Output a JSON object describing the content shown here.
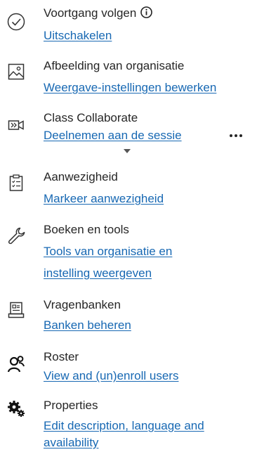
{
  "items": [
    {
      "title": "Voortgang volgen",
      "link": "Uitschakelen",
      "icon": "check-circle-icon"
    },
    {
      "title": "Afbeelding van organisatie",
      "link": "Weergave-instellingen bewerken",
      "icon": "image-icon"
    },
    {
      "title": "Class Collaborate",
      "link": "Deelnemen aan de sessie",
      "icon": "video-icon"
    },
    {
      "title": "Aanwezigheid",
      "link": "Markeer aanwezigheid",
      "icon": "clipboard-icon"
    },
    {
      "title": "Boeken en tools",
      "link_line1": "Tools van organisatie en",
      "link_line2": "instelling weergeven",
      "icon": "wrench-icon"
    },
    {
      "title": "Vragenbanken",
      "link": "Banken beheren",
      "icon": "question-bank-icon"
    },
    {
      "title": "Roster",
      "link": "View and (un)enroll users",
      "icon": "users-icon"
    },
    {
      "title": "Properties",
      "link_line1": "Edit description, language and",
      "link_line2": "availability",
      "icon": "gears-icon"
    }
  ],
  "colors": {
    "link": "#1768b3",
    "text": "#262626"
  }
}
